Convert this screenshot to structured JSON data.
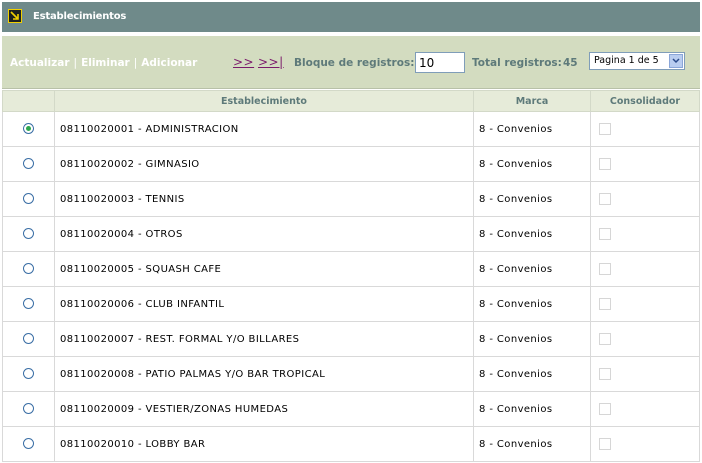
{
  "window": {
    "title": "Establecimientos"
  },
  "toolbar": {
    "actualizar": "Actualizar",
    "eliminar": "Eliminar",
    "adicionar": "Adicionar",
    "separator": "|",
    "next": ">>",
    "last": ">>|",
    "bloque_label": "Bloque de registros:",
    "bloque_value": "10",
    "total_label": "Total registros:",
    "total_value": "45",
    "page_select": "Pagina 1 de 5"
  },
  "table": {
    "headers": [
      "",
      "Establecimiento",
      "Marca",
      "Consolidador"
    ],
    "rows": [
      {
        "name": "08110020001 - ADMINISTRACION",
        "marca": "8 - Convenios",
        "selected": true
      },
      {
        "name": "08110020002 - GIMNASIO",
        "marca": "8 - Convenios",
        "selected": false
      },
      {
        "name": "08110020003 - TENNIS",
        "marca": "8 - Convenios",
        "selected": false
      },
      {
        "name": "08110020004 - OTROS",
        "marca": "8 - Convenios",
        "selected": false
      },
      {
        "name": "08110020005 - SQUASH CAFE",
        "marca": "8 - Convenios",
        "selected": false
      },
      {
        "name": "08110020006 - CLUB INFANTIL",
        "marca": "8 - Convenios",
        "selected": false
      },
      {
        "name": "08110020007 - REST. FORMAL Y/O BILLARES",
        "marca": "8 - Convenios",
        "selected": false
      },
      {
        "name": "08110020008 - PATIO PALMAS Y/O BAR TROPICAL",
        "marca": "8 - Convenios",
        "selected": false
      },
      {
        "name": "08110020009 - VESTIER/ZONAS HUMEDAS",
        "marca": "8 - Convenios",
        "selected": false
      },
      {
        "name": "08110020010 - LOBBY BAR",
        "marca": "8 - Convenios",
        "selected": false
      }
    ]
  },
  "colors": {
    "titlebar": "#6f8a8a",
    "toolbar": "#d3dcc0",
    "header": "#e6ebd9",
    "label": "#5e7a7a",
    "nav_link": "#7a1a6a",
    "radio_selected": "#2fa84f"
  }
}
